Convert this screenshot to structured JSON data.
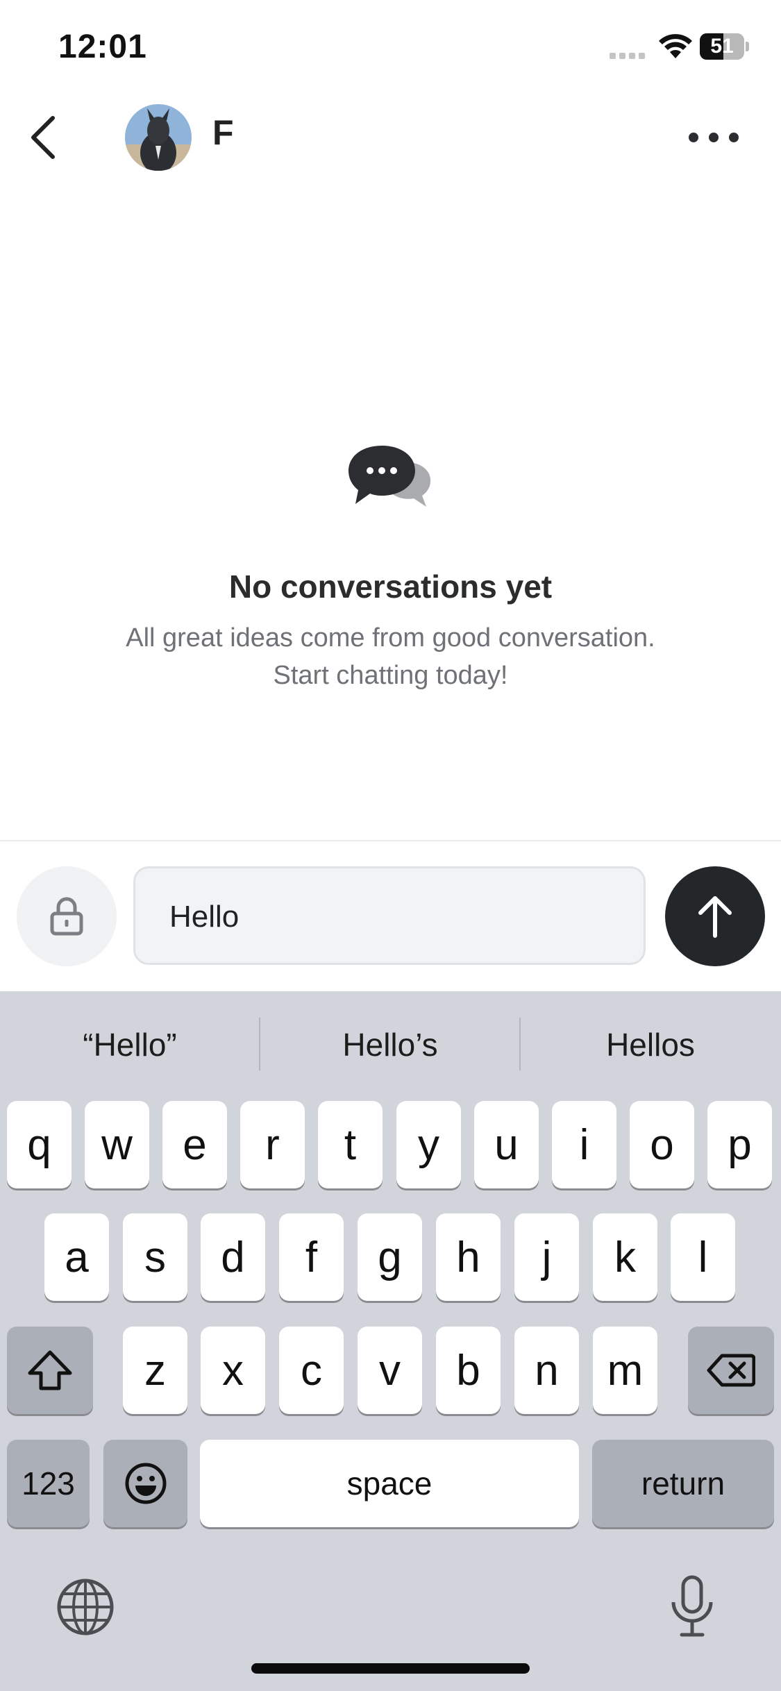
{
  "status_bar": {
    "time": "12:01",
    "battery": "51"
  },
  "header": {
    "contact_name": "F"
  },
  "empty_state": {
    "title": "No conversations yet",
    "line1": "All great ideas come from good conversation.",
    "line2": "Start chatting today!"
  },
  "composer": {
    "message_value": "Hello"
  },
  "keyboard": {
    "suggestions": [
      "“Hello”",
      "Hello’s",
      "Hellos"
    ],
    "row1": [
      "q",
      "w",
      "e",
      "r",
      "t",
      "y",
      "u",
      "i",
      "o",
      "p"
    ],
    "row2": [
      "a",
      "s",
      "d",
      "f",
      "g",
      "h",
      "j",
      "k",
      "l"
    ],
    "row3": [
      "z",
      "x",
      "c",
      "v",
      "b",
      "n",
      "m"
    ],
    "numbers_label": "123",
    "space_label": "space",
    "return_label": "return"
  },
  "icons": {
    "back": "chevron-left-icon",
    "more": "more-horizontal-icon",
    "chat": "chat-bubbles-icon",
    "lock": "lock-icon",
    "send": "arrow-up-icon",
    "shift": "shift-icon",
    "delete": "backspace-icon",
    "emoji": "emoji-icon",
    "globe": "globe-icon",
    "mic": "microphone-icon"
  },
  "colors": {
    "send_button": "#24272a",
    "keyboard_bg": "#d1d4da"
  }
}
